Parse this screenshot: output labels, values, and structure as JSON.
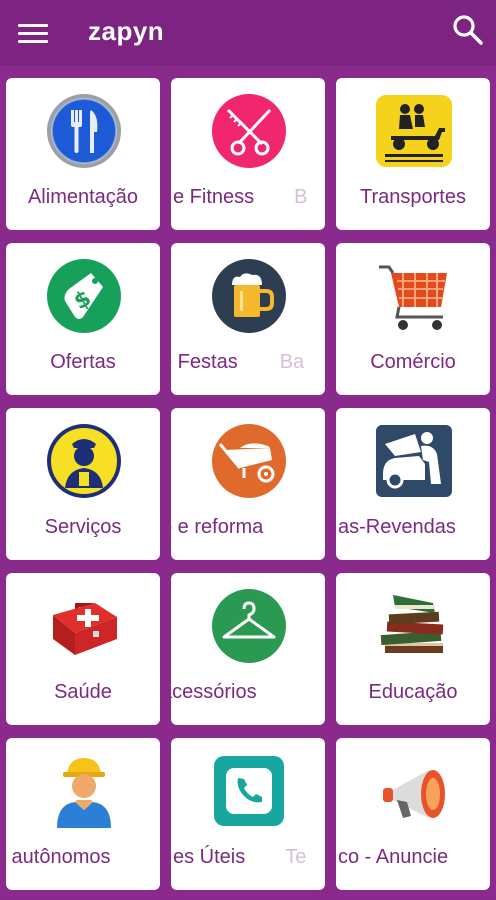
{
  "app": {
    "title": "zapyn"
  },
  "icons": {
    "menu": "hamburger-menu-icon",
    "search": "search-icon"
  },
  "colors": {
    "appbar": "#7d2482",
    "background": "#8a2a8c",
    "label": "#7a2a80"
  },
  "categories": [
    {
      "label": "Alimentação",
      "icon": "utensils-icon"
    },
    {
      "label": "e Fitness",
      "ghost": "B",
      "icon": "scissors-comb-icon"
    },
    {
      "label": "Transportes",
      "icon": "scooter-icon"
    },
    {
      "label": "Ofertas",
      "icon": "price-tag-icon"
    },
    {
      "label": "e Festas",
      "ghost": "Ba",
      "icon": "beer-mug-icon"
    },
    {
      "label": "Comércio",
      "icon": "shopping-cart-icon"
    },
    {
      "label": "Serviços",
      "icon": "maid-icon"
    },
    {
      "label": "o e reforma",
      "icon": "wheelbarrow-icon"
    },
    {
      "label": "as-Revendas",
      "icon": "car-mechanic-icon"
    },
    {
      "label": "Saúde",
      "icon": "first-aid-kit-icon"
    },
    {
      "label": "acessórios",
      "icon": "hanger-icon"
    },
    {
      "label": "Educação",
      "icon": "books-icon"
    },
    {
      "label": "s autônomos",
      "icon": "worker-icon"
    },
    {
      "label": "es Úteis",
      "ghost": "Te",
      "icon": "phone-icon"
    },
    {
      "label": "co - Anuncie",
      "icon": "megaphone-icon"
    }
  ]
}
